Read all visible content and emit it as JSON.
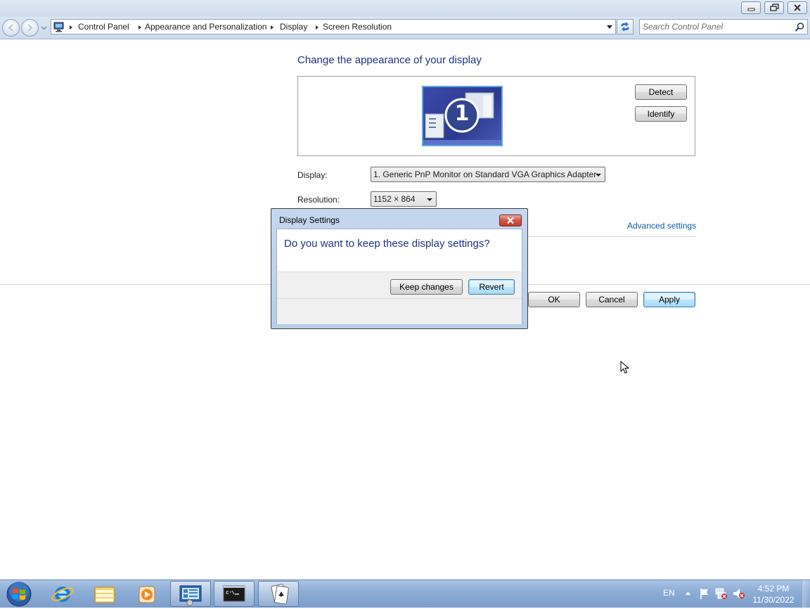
{
  "window": {
    "breadcrumb": [
      "Control Panel",
      "Appearance and Personalization",
      "Display",
      "Screen Resolution"
    ],
    "search_placeholder": "Search Control Panel"
  },
  "main": {
    "heading": "Change the appearance of your display",
    "monitor_number": "1",
    "detect_label": "Detect",
    "identify_label": "Identify",
    "display_label": "Display:",
    "display_value": "1. Generic PnP Monitor on Standard VGA Graphics Adapter",
    "resolution_label": "Resolution:",
    "resolution_value": "1152 × 864",
    "advanced_link": "Advanced settings",
    "ok_label": "OK",
    "cancel_label": "Cancel",
    "apply_label": "Apply"
  },
  "dialog": {
    "title": "Display Settings",
    "message": "Do you want to keep these display settings?",
    "keep_label": "Keep changes",
    "revert_label": "Revert"
  },
  "taskbar": {
    "language": "EN",
    "time": "4:52 PM",
    "date": "11/30/2022",
    "apps": [
      "start-button",
      "internet-explorer-icon",
      "windows-explorer-icon",
      "media-player-icon",
      "control-panel-icon",
      "command-prompt-icon",
      "solitaire-icon"
    ]
  },
  "colors": {
    "heading_blue": "#1e3287",
    "link_blue": "#0b5aa8",
    "taskbar": "#8eaed6"
  }
}
